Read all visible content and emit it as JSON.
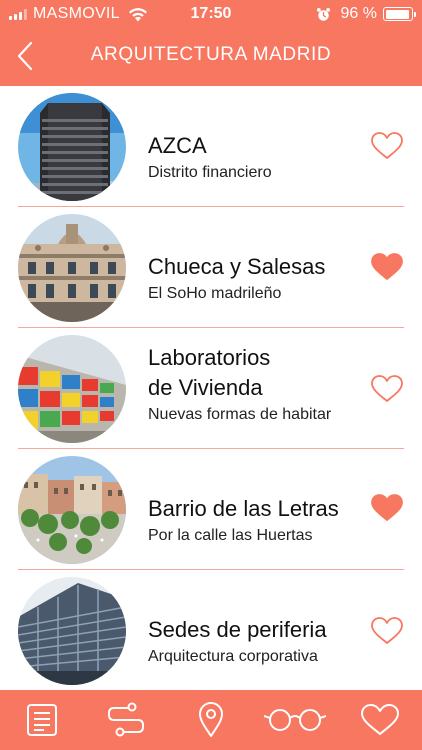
{
  "status_bar": {
    "carrier": "MASMOVIL",
    "time": "17:50",
    "battery": "96 %"
  },
  "nav": {
    "title": "ARQUITECTURA MADRID"
  },
  "colors": {
    "accent": "#f87761",
    "divider": "#f3a898",
    "text": "#111111"
  },
  "routes": [
    {
      "title": "AZCA",
      "subtitle": "Distrito financiero",
      "favorite": false
    },
    {
      "title": "Chueca y Salesas",
      "subtitle": "El SoHo madrileño",
      "favorite": true
    },
    {
      "title_line1": "Laboratorios",
      "title_line2": "de Vivienda",
      "subtitle": "Nuevas formas de habitar",
      "favorite": false
    },
    {
      "title": "Barrio de las Letras",
      "subtitle": "Por la calle las Huertas",
      "favorite": true
    },
    {
      "title": "Sedes de periferia",
      "subtitle": "Arquitectura corporativa",
      "favorite": false
    }
  ],
  "tab_bar": {
    "items": [
      "list-icon",
      "route-icon",
      "map-pin-icon",
      "glasses-icon",
      "heart-icon"
    ]
  }
}
